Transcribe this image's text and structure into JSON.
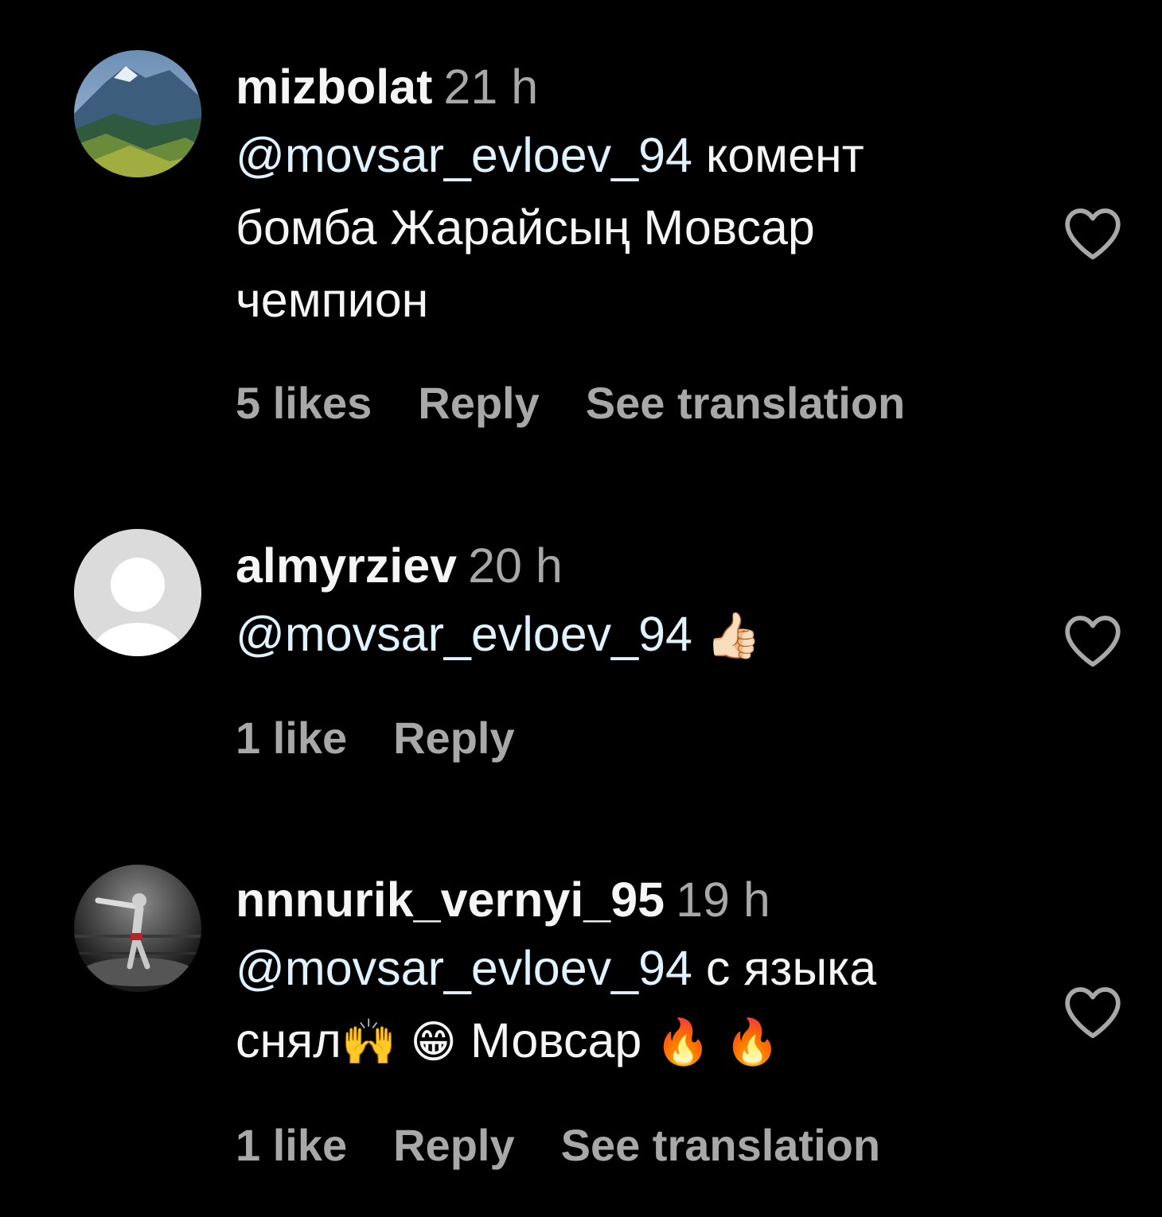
{
  "colors": {
    "background": "#000000",
    "primary_text": "#f5f5f5",
    "secondary_text": "#a8a8a8",
    "heart_outline": "#a8a8a8"
  },
  "comments": [
    {
      "username": "mizbolat",
      "time": "21 h",
      "mention": "@movsar_evloev_94",
      "text_line1_rest": " комент",
      "text_line2": "бомба Жарайсың Мовсар",
      "text_line3": "чемпион",
      "likes": "5 likes",
      "reply": "Reply",
      "translation": "See translation",
      "avatar_icon": "mountain-landscape-avatar",
      "like_icon": "heart-outline-icon"
    },
    {
      "username": "almyrziev",
      "time": "20 h",
      "mention": "@movsar_evloev_94",
      "emoji": "👍🏻",
      "likes": "1 like",
      "reply": "Reply",
      "avatar_icon": "default-person-avatar",
      "like_icon": "heart-outline-icon"
    },
    {
      "username": "nnnurik_vernyi_95",
      "time": "19 h",
      "mention": "@movsar_evloev_94",
      "text_line1_rest": " с языка",
      "text_line2_a": "снял",
      "emoji_a": "🙌",
      "emoji_b": "😁",
      "text_line2_b": " Мовсар ",
      "emoji_c": "🔥",
      "emoji_d": "🔥",
      "likes": "1 like",
      "reply": "Reply",
      "translation": "See translation",
      "avatar_icon": "fighter-avatar",
      "like_icon": "heart-outline-icon"
    }
  ]
}
